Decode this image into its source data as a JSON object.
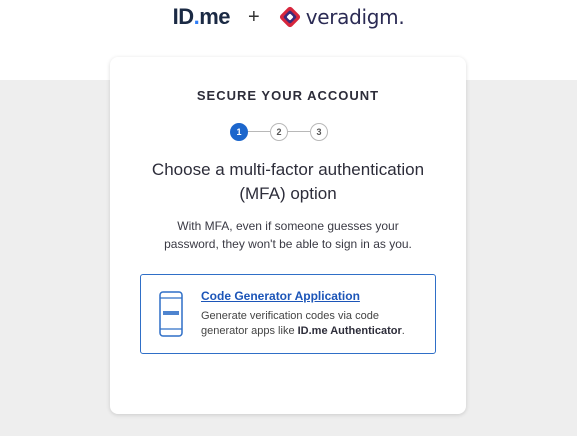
{
  "header": {
    "idme_logo": {
      "id": "ID",
      "dot": ".",
      "me": "me"
    },
    "plus": "+",
    "veradigm_logo": {
      "name": "veradigm",
      "mark": "."
    }
  },
  "card": {
    "title": "SECURE YOUR ACCOUNT",
    "steps": [
      "1",
      "2",
      "3"
    ],
    "active_step": 1,
    "heading": "Choose a multi-factor authentication (MFA) option",
    "description": "With MFA, even if someone guesses your password, they won't be able to sign in as you.",
    "option": {
      "title": "Code Generator Application",
      "description_prefix": "Generate verification codes via code generator apps like ",
      "description_bold": "ID.me Authenticator",
      "description_suffix": "."
    }
  },
  "colors": {
    "accent": "#1c66cc",
    "link": "#1c55b8",
    "border": "#2f6fc7",
    "background": "#eeeeee",
    "veradigm_red": "#d7263d"
  },
  "icons": {
    "option": "smartphone-icon",
    "veradigm": "veradigm-mark-icon"
  }
}
